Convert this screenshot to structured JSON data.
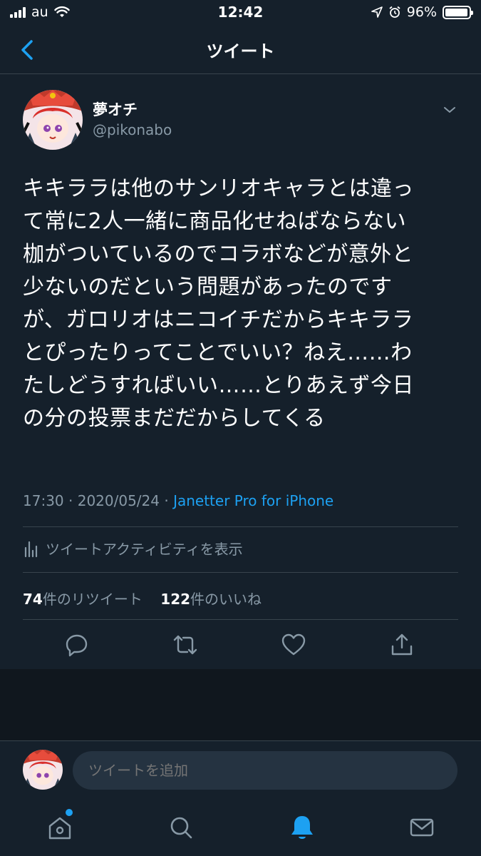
{
  "status_bar": {
    "carrier": "au",
    "time": "12:42",
    "battery": "96%",
    "battery_level": 0.96
  },
  "nav": {
    "title": "ツイート",
    "back_icon": "chevron-left-icon"
  },
  "author": {
    "name": "夢オチ",
    "handle": "@pikonabo"
  },
  "tweet": {
    "lines": [
      "キキララは他のサンリオキャラとは違っ",
      "て常に2人一緒に商品化せねばならない",
      "枷がついているのでコラボなどが意外と",
      "少ないのだという問題があったのです",
      "が、ガロリオはニコイチだからキキララ",
      "とぴったりってことでいい？ねえ……わ",
      "たしどうすればいい……とりあえず今日",
      "の分の投票まだだからしてくる"
    ],
    "time": "17:30",
    "separator": " · ",
    "date": "2020/05/24",
    "source": "Janetter Pro for iPhone"
  },
  "activity": {
    "label": "ツイートアクティビティを表示"
  },
  "stats": {
    "retweets_count": "74",
    "retweets_label": "件のリツイート",
    "likes_count": "122",
    "likes_label": "件のいいね"
  },
  "actions": [
    "reply-icon",
    "retweet-icon",
    "like-icon",
    "share-icon"
  ],
  "reply": {
    "placeholder": "ツイートを追加"
  },
  "tabs": [
    "home-icon",
    "search-icon",
    "notifications-icon",
    "messages-icon"
  ],
  "colors": {
    "background": "#15202b",
    "accent": "#1da1f2",
    "secondary_text": "#8899a6",
    "divider": "#38444d"
  }
}
